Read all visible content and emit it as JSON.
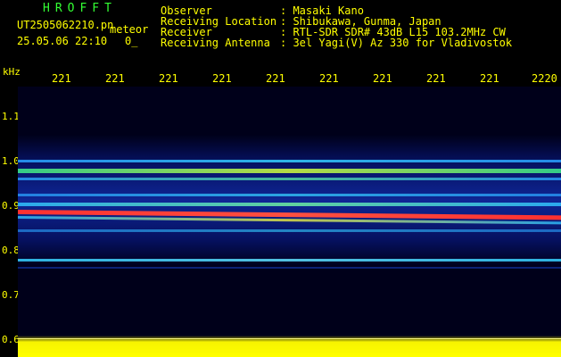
{
  "header": {
    "app_title": "HROFFT",
    "filename": "UT2505062210.pn",
    "file_suffix": "meteor",
    "datetime": "25.05.06 22:10",
    "datetime_extra": "0_"
  },
  "meta": [
    {
      "key": "Observer",
      "value": ": Masaki Kano"
    },
    {
      "key": "Receiving Location",
      "value": ": Shibukawa, Gunma, Japan"
    },
    {
      "key": "Receiver",
      "value": ": RTL-SDR SDR# 43dB L15 103.2MHz CW"
    },
    {
      "key": "Receiving Antenna",
      "value": ": 3el Yagi(V) Az 330 for Vladivostok"
    }
  ],
  "axis": {
    "y_unit": "kHz",
    "y_ticks": [
      "1.1",
      "1.0",
      "0.9",
      "0.8",
      "0.7",
      "0.6"
    ],
    "x_ticks": [
      "221",
      "221",
      "221",
      "221",
      "221",
      "221",
      "221",
      "221",
      "221",
      "2220"
    ]
  },
  "colors": {
    "text": "#ffff00",
    "title": "#33ff33",
    "background": "#000000",
    "signal": "#ff3030"
  }
}
